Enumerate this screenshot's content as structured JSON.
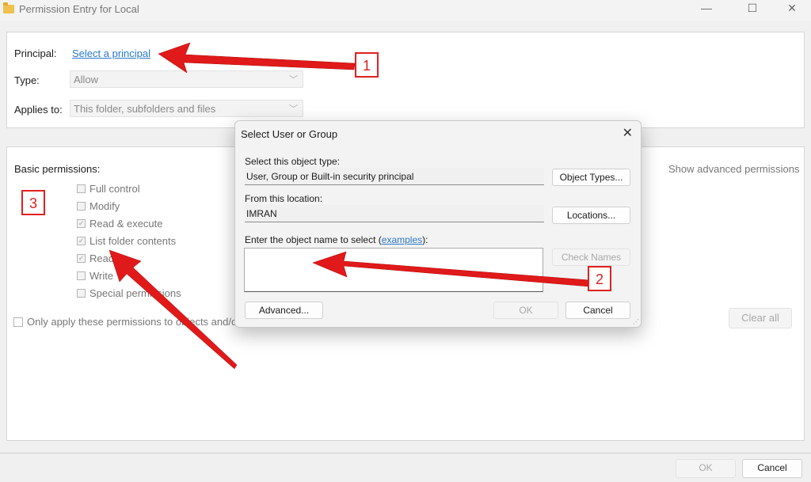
{
  "window": {
    "title": "Permission Entry for Local",
    "minimize": "—",
    "maximize": "☐",
    "close": "✕"
  },
  "principal": {
    "label": "Principal:",
    "link": "Select a principal"
  },
  "type": {
    "label": "Type:",
    "value": "Allow"
  },
  "applies_to": {
    "label": "Applies to:",
    "value": "This folder, subfolders and files"
  },
  "basic_permissions": {
    "heading": "Basic permissions:",
    "show_advanced": "Show advanced permissions",
    "items": [
      {
        "label": "Full control",
        "checked": false
      },
      {
        "label": "Modify",
        "checked": false
      },
      {
        "label": "Read & execute",
        "checked": true
      },
      {
        "label": "List folder contents",
        "checked": true
      },
      {
        "label": "Read",
        "checked": true
      },
      {
        "label": "Write",
        "checked": false
      },
      {
        "label": "Special permissions",
        "checked": false
      }
    ],
    "only_apply": "Only apply these permissions to objects and/or containers within this container",
    "clear_all": "Clear all"
  },
  "dialog": {
    "title": "Select User or Group",
    "close": "✕",
    "object_type_label": "Select this object type:",
    "object_type_value": "User, Group or Built-in security principal",
    "object_types_button": "Object Types...",
    "location_label": "From this location:",
    "location_value": "IMRAN",
    "locations_button": "Locations...",
    "enter_label_prefix": "Enter the object name to select (",
    "enter_label_link": "examples",
    "enter_label_suffix": "):",
    "object_name_value": "",
    "check_names_button": "Check Names",
    "advanced_button": "Advanced...",
    "ok_button": "OK",
    "cancel_button": "Cancel"
  },
  "footer": {
    "ok_button": "OK",
    "cancel_button": "Cancel"
  },
  "annotations": {
    "badge1": "1",
    "badge2": "2",
    "badge3": "3",
    "arrow_color": "#e01a1a"
  }
}
